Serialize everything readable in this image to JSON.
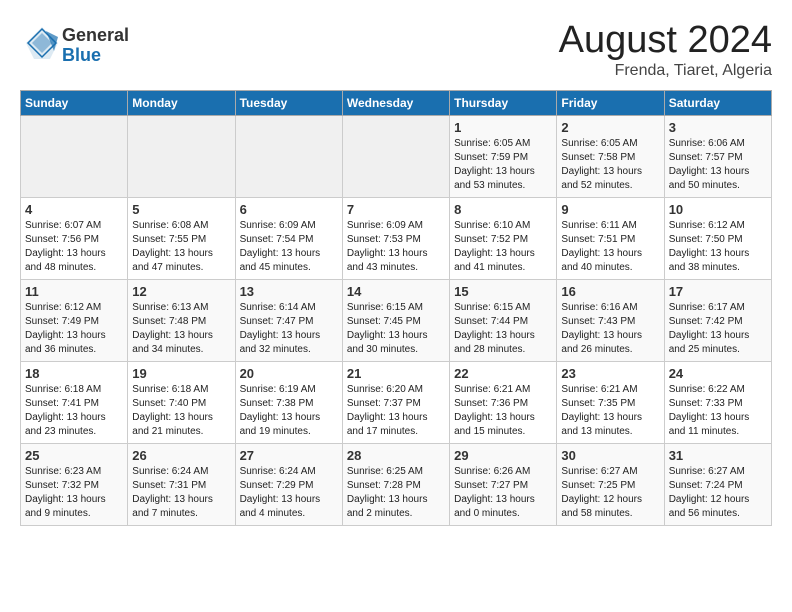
{
  "logo": {
    "general": "General",
    "blue": "Blue"
  },
  "title": "August 2024",
  "subtitle": "Frenda, Tiaret, Algeria",
  "days_of_week": [
    "Sunday",
    "Monday",
    "Tuesday",
    "Wednesday",
    "Thursday",
    "Friday",
    "Saturday"
  ],
  "weeks": [
    [
      {
        "num": "",
        "info": ""
      },
      {
        "num": "",
        "info": ""
      },
      {
        "num": "",
        "info": ""
      },
      {
        "num": "",
        "info": ""
      },
      {
        "num": "1",
        "sunrise": "6:05 AM",
        "sunset": "7:59 PM",
        "daylight": "13 hours and 53 minutes."
      },
      {
        "num": "2",
        "sunrise": "6:05 AM",
        "sunset": "7:58 PM",
        "daylight": "13 hours and 52 minutes."
      },
      {
        "num": "3",
        "sunrise": "6:06 AM",
        "sunset": "7:57 PM",
        "daylight": "13 hours and 50 minutes."
      }
    ],
    [
      {
        "num": "4",
        "sunrise": "6:07 AM",
        "sunset": "7:56 PM",
        "daylight": "13 hours and 48 minutes."
      },
      {
        "num": "5",
        "sunrise": "6:08 AM",
        "sunset": "7:55 PM",
        "daylight": "13 hours and 47 minutes."
      },
      {
        "num": "6",
        "sunrise": "6:09 AM",
        "sunset": "7:54 PM",
        "daylight": "13 hours and 45 minutes."
      },
      {
        "num": "7",
        "sunrise": "6:09 AM",
        "sunset": "7:53 PM",
        "daylight": "13 hours and 43 minutes."
      },
      {
        "num": "8",
        "sunrise": "6:10 AM",
        "sunset": "7:52 PM",
        "daylight": "13 hours and 41 minutes."
      },
      {
        "num": "9",
        "sunrise": "6:11 AM",
        "sunset": "7:51 PM",
        "daylight": "13 hours and 40 minutes."
      },
      {
        "num": "10",
        "sunrise": "6:12 AM",
        "sunset": "7:50 PM",
        "daylight": "13 hours and 38 minutes."
      }
    ],
    [
      {
        "num": "11",
        "sunrise": "6:12 AM",
        "sunset": "7:49 PM",
        "daylight": "13 hours and 36 minutes."
      },
      {
        "num": "12",
        "sunrise": "6:13 AM",
        "sunset": "7:48 PM",
        "daylight": "13 hours and 34 minutes."
      },
      {
        "num": "13",
        "sunrise": "6:14 AM",
        "sunset": "7:47 PM",
        "daylight": "13 hours and 32 minutes."
      },
      {
        "num": "14",
        "sunrise": "6:15 AM",
        "sunset": "7:45 PM",
        "daylight": "13 hours and 30 minutes."
      },
      {
        "num": "15",
        "sunrise": "6:15 AM",
        "sunset": "7:44 PM",
        "daylight": "13 hours and 28 minutes."
      },
      {
        "num": "16",
        "sunrise": "6:16 AM",
        "sunset": "7:43 PM",
        "daylight": "13 hours and 26 minutes."
      },
      {
        "num": "17",
        "sunrise": "6:17 AM",
        "sunset": "7:42 PM",
        "daylight": "13 hours and 25 minutes."
      }
    ],
    [
      {
        "num": "18",
        "sunrise": "6:18 AM",
        "sunset": "7:41 PM",
        "daylight": "13 hours and 23 minutes."
      },
      {
        "num": "19",
        "sunrise": "6:18 AM",
        "sunset": "7:40 PM",
        "daylight": "13 hours and 21 minutes."
      },
      {
        "num": "20",
        "sunrise": "6:19 AM",
        "sunset": "7:38 PM",
        "daylight": "13 hours and 19 minutes."
      },
      {
        "num": "21",
        "sunrise": "6:20 AM",
        "sunset": "7:37 PM",
        "daylight": "13 hours and 17 minutes."
      },
      {
        "num": "22",
        "sunrise": "6:21 AM",
        "sunset": "7:36 PM",
        "daylight": "13 hours and 15 minutes."
      },
      {
        "num": "23",
        "sunrise": "6:21 AM",
        "sunset": "7:35 PM",
        "daylight": "13 hours and 13 minutes."
      },
      {
        "num": "24",
        "sunrise": "6:22 AM",
        "sunset": "7:33 PM",
        "daylight": "13 hours and 11 minutes."
      }
    ],
    [
      {
        "num": "25",
        "sunrise": "6:23 AM",
        "sunset": "7:32 PM",
        "daylight": "13 hours and 9 minutes."
      },
      {
        "num": "26",
        "sunrise": "6:24 AM",
        "sunset": "7:31 PM",
        "daylight": "13 hours and 7 minutes."
      },
      {
        "num": "27",
        "sunrise": "6:24 AM",
        "sunset": "7:29 PM",
        "daylight": "13 hours and 4 minutes."
      },
      {
        "num": "28",
        "sunrise": "6:25 AM",
        "sunset": "7:28 PM",
        "daylight": "13 hours and 2 minutes."
      },
      {
        "num": "29",
        "sunrise": "6:26 AM",
        "sunset": "7:27 PM",
        "daylight": "13 hours and 0 minutes."
      },
      {
        "num": "30",
        "sunrise": "6:27 AM",
        "sunset": "7:25 PM",
        "daylight": "12 hours and 58 minutes."
      },
      {
        "num": "31",
        "sunrise": "6:27 AM",
        "sunset": "7:24 PM",
        "daylight": "12 hours and 56 minutes."
      }
    ]
  ],
  "labels": {
    "sunrise": "Sunrise:",
    "sunset": "Sunset:",
    "daylight": "Daylight:"
  }
}
